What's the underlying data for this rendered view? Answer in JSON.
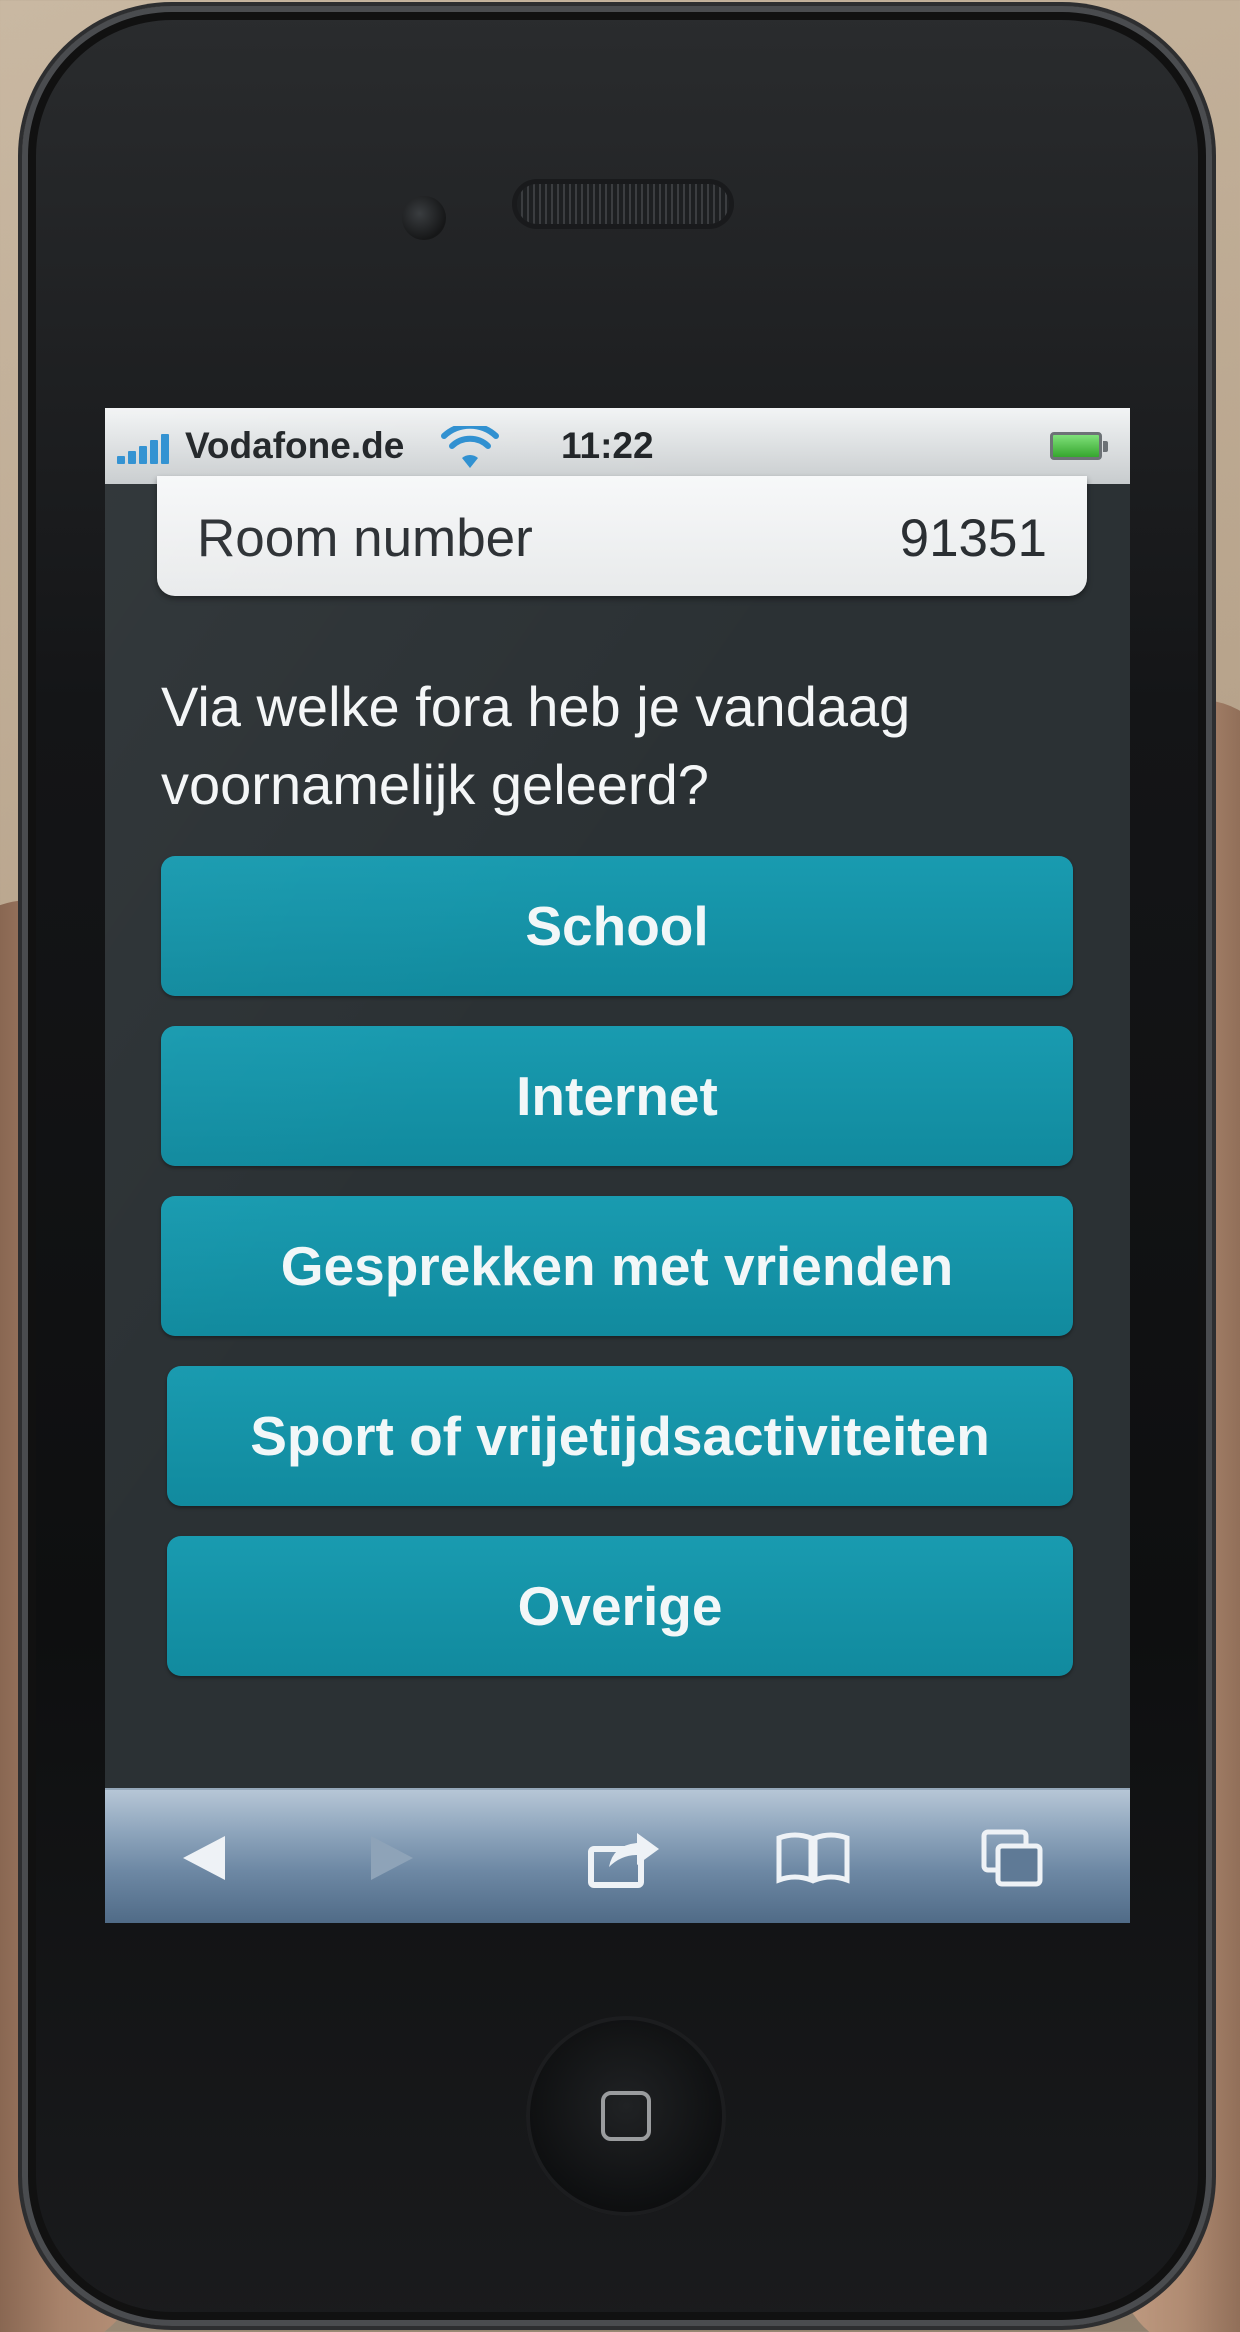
{
  "status_bar": {
    "carrier": "Vodafone.de",
    "time": "11:22",
    "signal_icon": "signal-bars-icon",
    "wifi_icon": "wifi-icon",
    "battery_icon": "battery-icon"
  },
  "room": {
    "label": "Room number",
    "value": "91351"
  },
  "question": {
    "line1": "Via welke fora heb je vandaag",
    "line2": "voornamelijk geleerd?"
  },
  "options": [
    {
      "label": "School"
    },
    {
      "label": "Internet"
    },
    {
      "label": "Gesprekken met vrienden"
    },
    {
      "label": "Sport of vrijetijdsactiviteiten"
    },
    {
      "label": "Overige"
    }
  ],
  "toolbar": {
    "back_icon": "back-arrow-icon",
    "forward_icon": "forward-arrow-icon",
    "share_icon": "share-icon",
    "bookmarks_icon": "bookmarks-book-icon",
    "pages_icon": "pages-icon"
  },
  "colors": {
    "option_bg": "#1597ab",
    "screen_bg": "#2b3134",
    "toolbar_bg": "#6d88a4",
    "signal": "#2d8fd0",
    "battery": "#36a62e"
  }
}
